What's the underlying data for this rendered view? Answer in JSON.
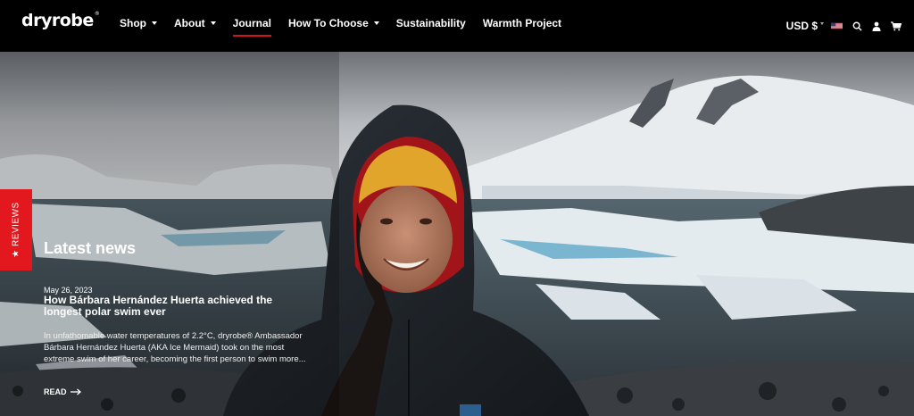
{
  "brand": {
    "logo_text": "dryrobe",
    "logo_mark": "®"
  },
  "nav": {
    "items": [
      {
        "label": "Shop",
        "has_dropdown": true
      },
      {
        "label": "About",
        "has_dropdown": true
      },
      {
        "label": "Journal",
        "has_dropdown": false,
        "active": true
      },
      {
        "label": "How To Choose",
        "has_dropdown": true
      },
      {
        "label": "Sustainability",
        "has_dropdown": false
      },
      {
        "label": "Warmth Project",
        "has_dropdown": false
      }
    ]
  },
  "utility": {
    "currency": "USD $",
    "flag": "us-flag-icon",
    "icons": [
      "search-icon",
      "user-icon",
      "cart-icon"
    ]
  },
  "colors": {
    "accent": "#d3151c",
    "reviews_tab": "#e3171e",
    "header_bg": "#000000"
  },
  "reviews_tab": {
    "label": "★ REVIEWS"
  },
  "news": {
    "heading": "Latest news",
    "date": "May 26, 2023",
    "title": "How Bárbara Hernández Huerta achieved the longest polar swim ever",
    "excerpt": "In unfathomable water temperatures of 2.2°C, dryrobe® Ambassador Bárbara Hernández Huerta (AKA Ice Mermaid) took on the most extreme swim of her career, becoming the first person to swim more...",
    "read_label": "READ"
  }
}
